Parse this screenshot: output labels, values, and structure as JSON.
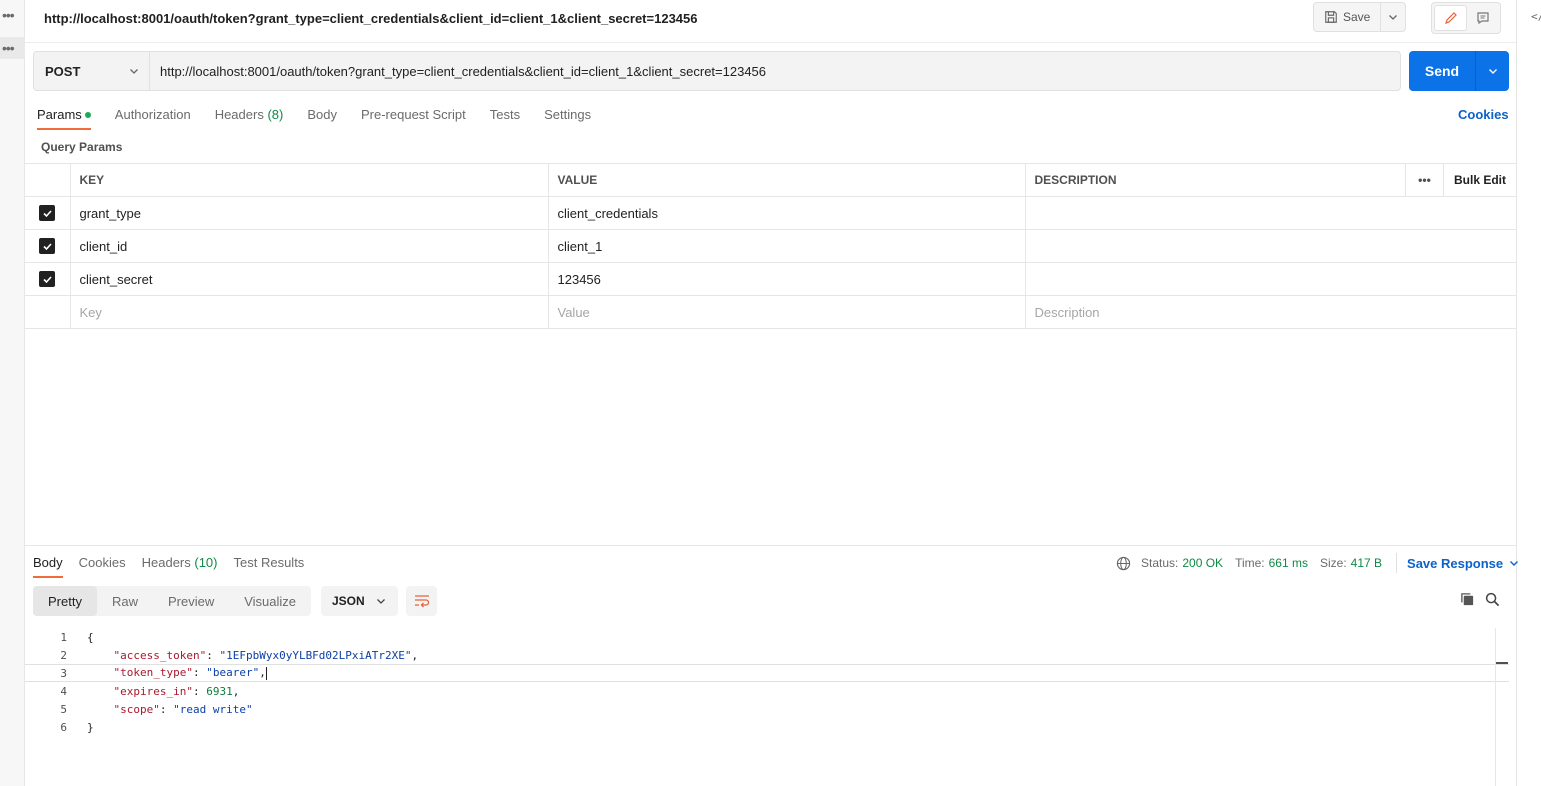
{
  "request": {
    "title": "http://localhost:8001/oauth/token?grant_type=client_credentials&client_id=client_1&client_secret=123456",
    "save_label": "Save",
    "method": "POST",
    "url": "http://localhost:8001/oauth/token?grant_type=client_credentials&client_id=client_1&client_secret=123456",
    "send_label": "Send"
  },
  "request_tabs": [
    {
      "label": "Params",
      "active": true,
      "dot": true
    },
    {
      "label": "Authorization"
    },
    {
      "label": "Headers",
      "count": "(8)"
    },
    {
      "label": "Body"
    },
    {
      "label": "Pre-request Script"
    },
    {
      "label": "Tests"
    },
    {
      "label": "Settings"
    }
  ],
  "cookies_label": "Cookies",
  "query_params": {
    "section_label": "Query Params",
    "columns": {
      "key": "KEY",
      "value": "VALUE",
      "description": "DESCRIPTION",
      "bulk_edit": "Bulk Edit"
    },
    "rows": [
      {
        "key": "grant_type",
        "value": "client_credentials",
        "description": "",
        "checked": true
      },
      {
        "key": "client_id",
        "value": "client_1",
        "description": "",
        "checked": true
      },
      {
        "key": "client_secret",
        "value": "123456",
        "description": "",
        "checked": true
      }
    ],
    "placeholders": {
      "key": "Key",
      "value": "Value",
      "description": "Description"
    }
  },
  "response_tabs": [
    {
      "label": "Body",
      "active": true
    },
    {
      "label": "Cookies"
    },
    {
      "label": "Headers",
      "count": "(10)"
    },
    {
      "label": "Test Results"
    }
  ],
  "response_status": {
    "status_label": "Status:",
    "status": "200 OK",
    "time_label": "Time:",
    "time": "661 ms",
    "size_label": "Size:",
    "size": "417 B",
    "save_response": "Save Response"
  },
  "view_modes": [
    "Pretty",
    "Raw",
    "Preview",
    "Visualize"
  ],
  "format": "JSON",
  "response_body": {
    "access_token": "1EFpbWyx0yYLBFd02LPxiATr2XE",
    "token_type": "bearer",
    "expires_in": "6931",
    "scope": "read write"
  },
  "line_numbers": [
    "1",
    "2",
    "3",
    "4",
    "5",
    "6"
  ],
  "colors": {
    "accent": "#f26b3a",
    "send": "#0b72e7",
    "link": "#0b63c9",
    "ok": "#0f8a45"
  }
}
